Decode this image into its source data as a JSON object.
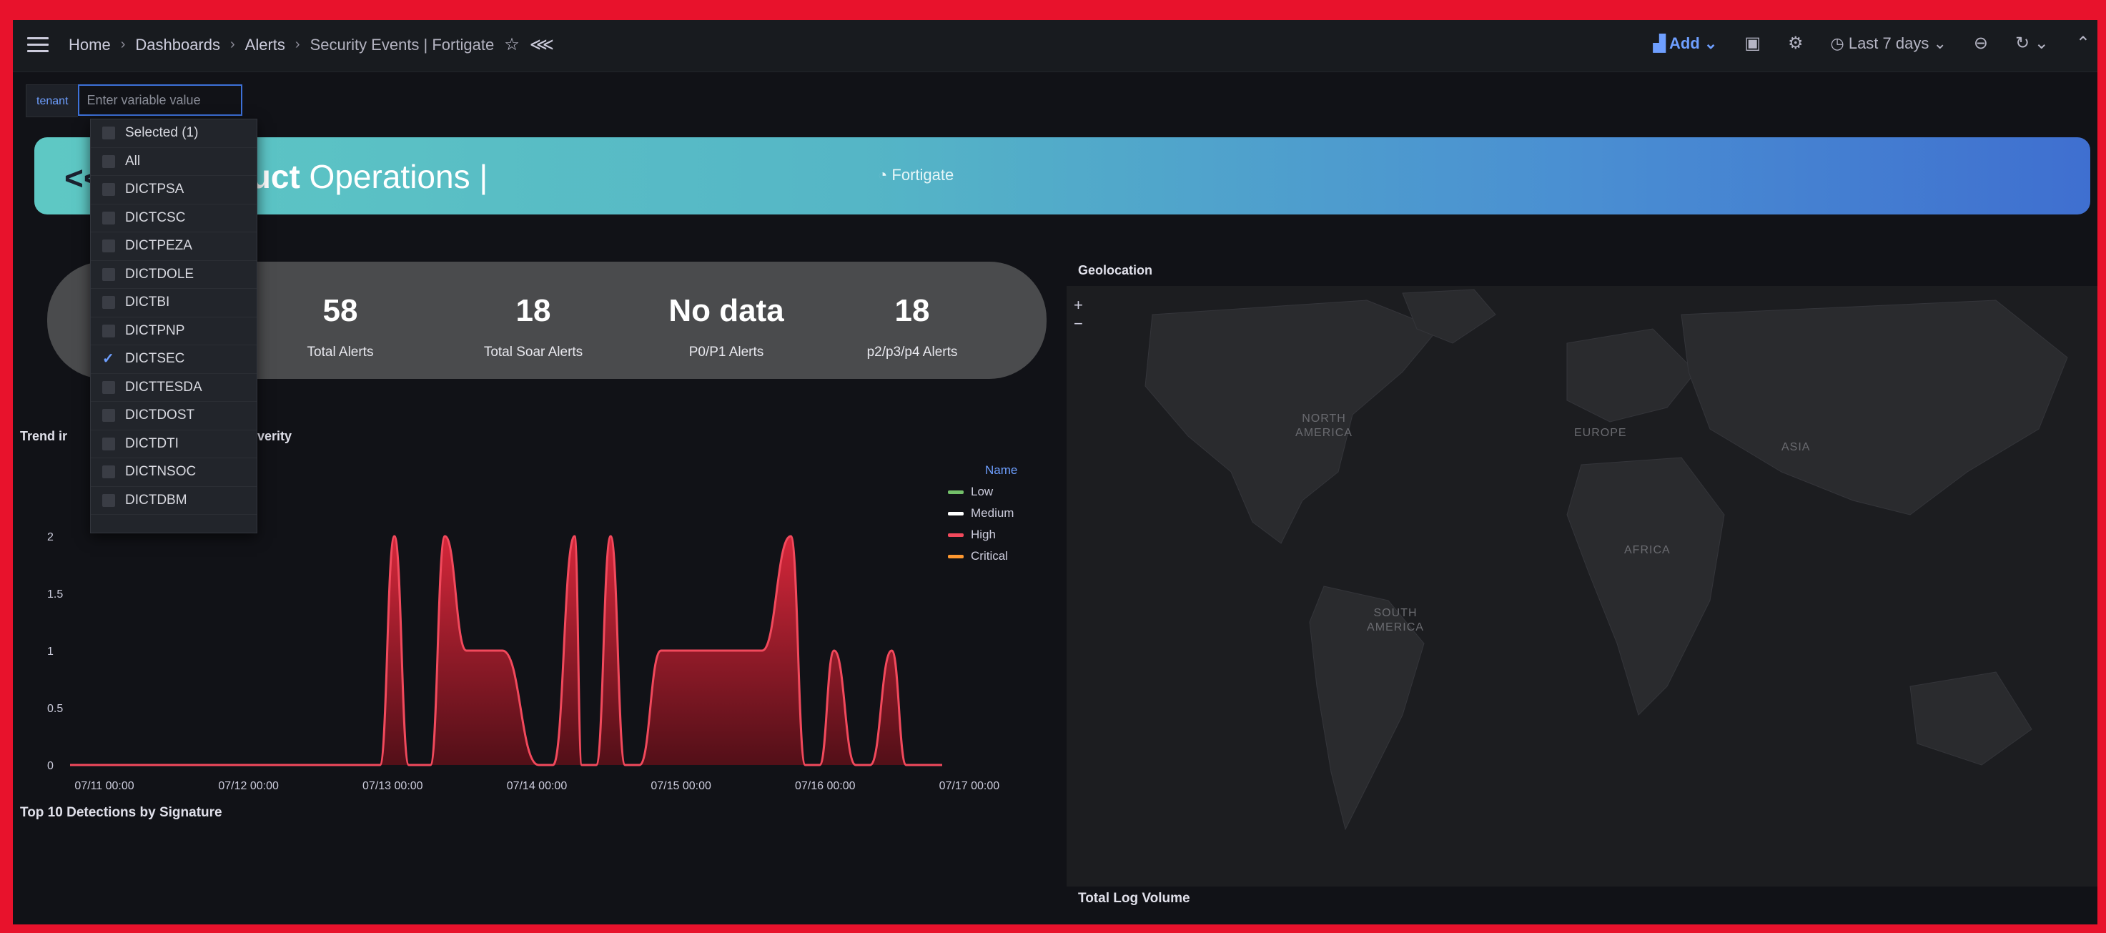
{
  "breadcrumbs": [
    "Home",
    "Dashboards",
    "Alerts",
    "Security Events | Fortigate"
  ],
  "toolbar": {
    "add_label": "Add",
    "time_range": "Last 7 days"
  },
  "variable": {
    "label": "tenant",
    "placeholder": "Enter variable value"
  },
  "dropdown": {
    "selected_label": "Selected (1)",
    "all_label": "All",
    "options": [
      {
        "label": "DICTPSA",
        "checked": false
      },
      {
        "label": "DICTCSC",
        "checked": false
      },
      {
        "label": "DICTPEZA",
        "checked": false
      },
      {
        "label": "DICTDOLE",
        "checked": false
      },
      {
        "label": "DICTBI",
        "checked": false
      },
      {
        "label": "DICTPNP",
        "checked": false
      },
      {
        "label": "DICTSEC",
        "checked": true
      },
      {
        "label": "DICTTESDA",
        "checked": false
      },
      {
        "label": "DICTDOST",
        "checked": false
      },
      {
        "label": "DICTDTI",
        "checked": false
      },
      {
        "label": "DICTNSOC",
        "checked": false
      },
      {
        "label": "DICTDBM",
        "checked": false
      }
    ]
  },
  "banner": {
    "arrow": "<<",
    "title_bold": "luct",
    "title_rest": " Operations |",
    "subtitle": "Fortigate"
  },
  "stats": [
    {
      "value": "58",
      "label": "Total Alerts"
    },
    {
      "value": "18",
      "label": "Total Soar Alerts"
    },
    {
      "value": "No data",
      "label": "P0/P1 Alerts"
    },
    {
      "value": "18",
      "label": "p2/p3/p4 Alerts"
    }
  ],
  "panels": {
    "trend_title_part1": "Trend ir",
    "trend_title_part2": "Severity",
    "geo_title": "Geolocation",
    "top10_title": "Top 10 Detections by Signature",
    "log_volume_title": "Total Log Volume"
  },
  "legend": {
    "header": "Name",
    "items": [
      {
        "label": "Low",
        "color": "#73bf69"
      },
      {
        "label": "Medium",
        "color": "#ffffff"
      },
      {
        "label": "High",
        "color": "#f2495c"
      },
      {
        "label": "Critical",
        "color": "#ff9830"
      }
    ]
  },
  "map_labels": [
    "NORTH AMERICA",
    "EUROPE",
    "ASIA",
    "AFRICA",
    "SOUTH AMERICA"
  ],
  "chart_data": {
    "type": "area",
    "x_ticks": [
      "07/11 00:00",
      "07/12 00:00",
      "07/13 00:00",
      "07/14 00:00",
      "07/15 00:00",
      "07/16 00:00",
      "07/17 00:00"
    ],
    "y_ticks": [
      "0",
      "0.5",
      "1",
      "1.5",
      "2"
    ],
    "ylim": [
      0,
      2.2
    ],
    "series": [
      {
        "name": "High",
        "color": "#f2495c",
        "x": [
          0,
          1.8,
          2.15,
          2.25,
          2.35,
          2.5,
          2.6,
          2.75,
          2.85,
          3.0,
          3.25,
          3.35,
          3.5,
          3.55,
          3.65,
          3.75,
          3.85,
          3.95,
          4.1,
          4.3,
          4.6,
          4.8,
          5.0,
          5.1,
          5.2,
          5.3,
          5.45,
          5.55,
          5.7,
          5.8,
          5.9,
          6.0,
          6.05
        ],
        "y": [
          0,
          0,
          0,
          2,
          0,
          0,
          2,
          1,
          1,
          1,
          0,
          0,
          2,
          0,
          0,
          2,
          0,
          0,
          1,
          1,
          1,
          1,
          2,
          0,
          0,
          1,
          0,
          0,
          1,
          0,
          0,
          0,
          0
        ]
      }
    ]
  }
}
